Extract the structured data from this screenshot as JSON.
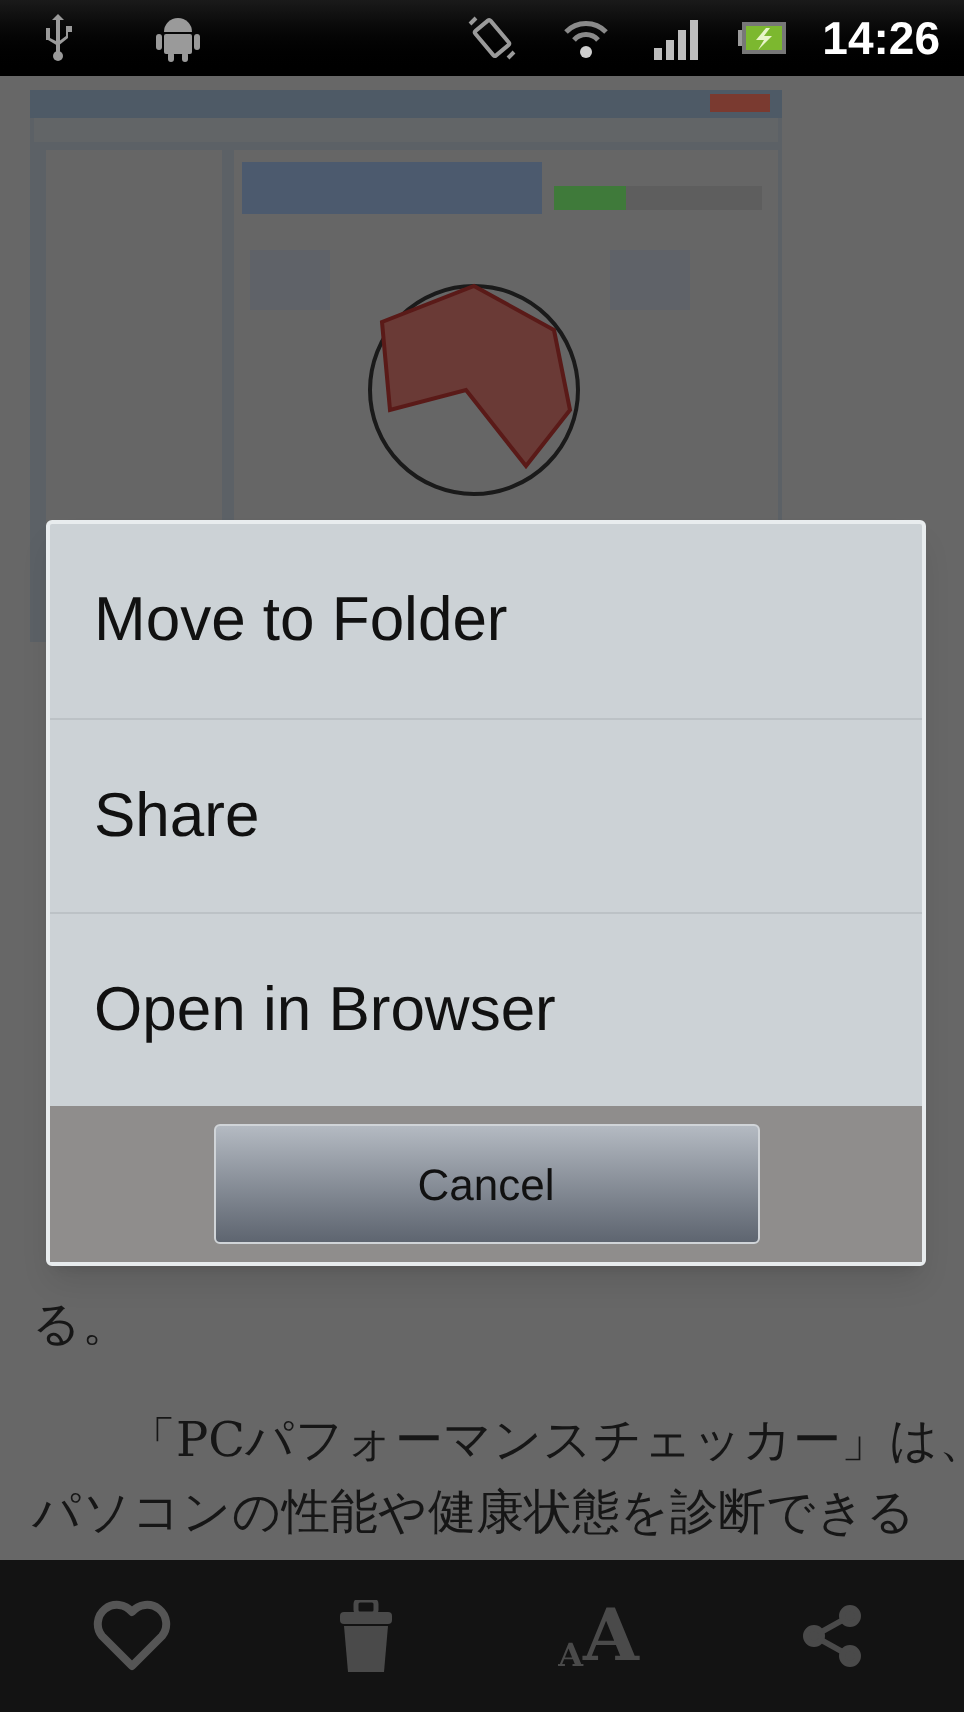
{
  "status_bar": {
    "time": "14:26"
  },
  "article": {
    "paragraphs": [
      {
        "lines": [
          "る。"
        ],
        "indent": false
      },
      {
        "lines": [
          "「PCパフォーマンスチェッカー」は、",
          "パソコンの性能や健康状態を診断できる"
        ],
        "indent": true
      }
    ]
  },
  "dialog": {
    "items": [
      {
        "label": "Move to Folder"
      },
      {
        "label": "Share"
      },
      {
        "label": "Open in Browser"
      }
    ],
    "cancel": "Cancel"
  },
  "toolbar": [
    {
      "kind": "heart"
    },
    {
      "kind": "trash"
    },
    {
      "kind": "font-size",
      "small": "A",
      "large": "A"
    },
    {
      "kind": "share"
    }
  ]
}
